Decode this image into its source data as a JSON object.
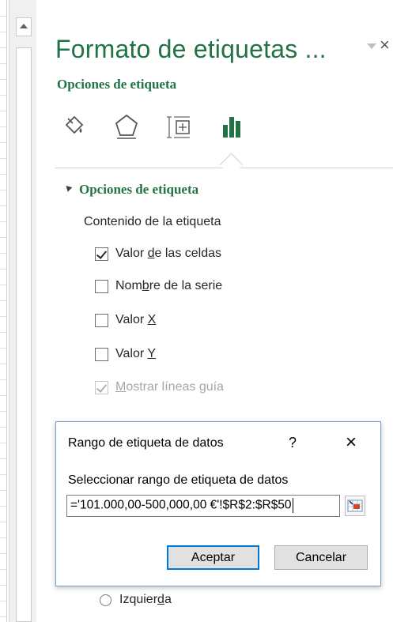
{
  "pane": {
    "title": "Formato de etiquetas ...",
    "close_glyph": "×",
    "subtitle": "Opciones de etiqueta",
    "tabs": [
      {
        "icon": "fill-line-icon"
      },
      {
        "icon": "effects-pentagon-icon"
      },
      {
        "icon": "size-properties-icon"
      },
      {
        "icon": "bar-chart-options-icon",
        "selected": true
      }
    ],
    "section_title": "Opciones de etiqueta",
    "content_label": "Contenido de la etiqueta",
    "options": [
      {
        "pre": "Valor ",
        "key": "d",
        "post": "e las celdas",
        "checked": true,
        "disabled": false
      },
      {
        "pre": "Nom",
        "key": "b",
        "post": "re de la serie",
        "checked": false,
        "disabled": false
      },
      {
        "pre": "Valor ",
        "key": "X",
        "post": "",
        "checked": false,
        "disabled": false
      },
      {
        "pre": "Valor ",
        "key": "Y",
        "post": "",
        "checked": false,
        "disabled": false
      },
      {
        "pre": "",
        "key": "M",
        "post": "ostrar líneas guía",
        "checked": true,
        "disabled": true
      }
    ],
    "radio_left": {
      "pre": "Izquier",
      "key": "d",
      "post": "a"
    }
  },
  "dialog": {
    "title": "Rango de etiqueta de datos",
    "help": "?",
    "close": "×",
    "label": "Seleccionar rango de etiqueta de datos",
    "input_value": "='101.000,00-500,000,00 €'!$R$2:$R$50",
    "ok_label": "Aceptar",
    "cancel_label": "Cancelar"
  },
  "colors": {
    "accent": "#217346",
    "focus": "#0078d7"
  }
}
